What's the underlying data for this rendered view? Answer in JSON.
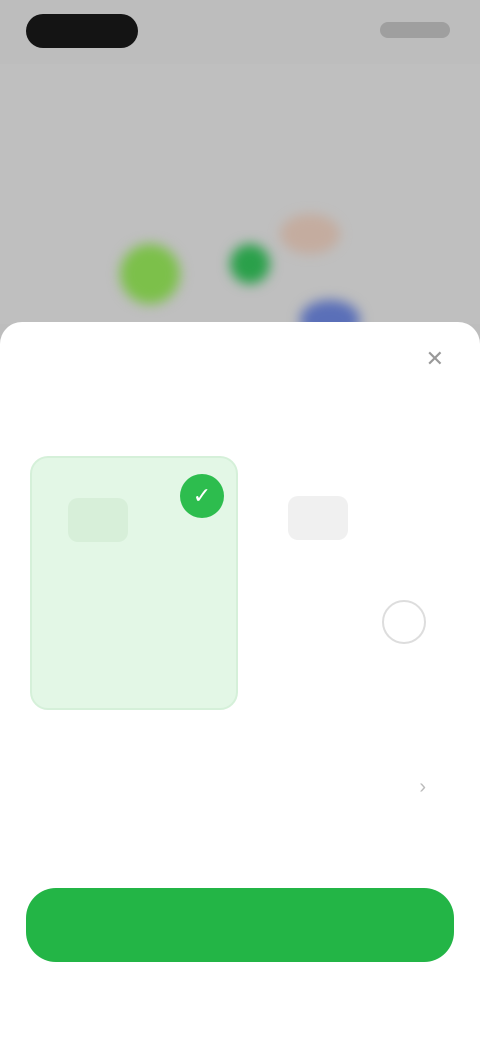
{
  "status": {
    "left": "",
    "right": ""
  },
  "header": {
    "icon": "close-icon"
  },
  "illustration": {
    "blobs": [
      {
        "color": "#7cc04a"
      },
      {
        "color": "#2aa04a"
      },
      {
        "color": "#c8a08a"
      },
      {
        "color": "#5a6fb8"
      },
      {
        "color": "#c9a58a"
      }
    ]
  },
  "sheet": {
    "title": "",
    "close_icon": "close-icon",
    "tabs": [
      {
        "label": ""
      },
      {
        "label": ""
      }
    ],
    "cards": [
      {
        "title": "",
        "description": "",
        "selected": true
      },
      {
        "title": "",
        "description": "",
        "selected": false
      }
    ],
    "row": {
      "title": "",
      "subtitle": ""
    },
    "cta_label": "",
    "footer": ""
  },
  "colors": {
    "accent": "#23b546",
    "selected_card": "#e3f7e6"
  }
}
